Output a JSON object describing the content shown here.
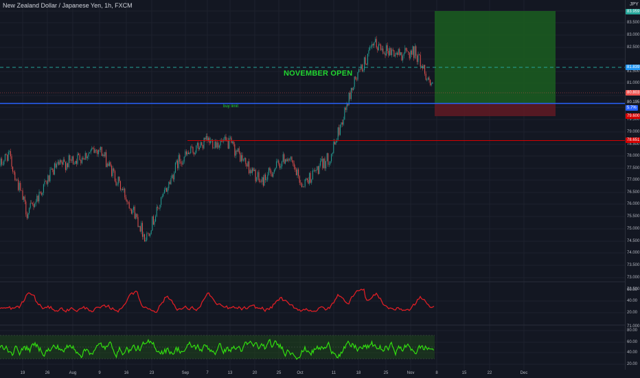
{
  "header": {
    "title": "New Zealand Dollar / Japanese Yen, 1h, FXCM",
    "currency": "JPY"
  },
  "annotations": {
    "november_open": "NOVEMBER OPEN",
    "buy_limit": "buy limit"
  },
  "price_axis": {
    "ticks": [
      "83.500",
      "83.000",
      "82.500",
      "81.500",
      "81.000",
      "79.500",
      "79.000",
      "78.500",
      "78.000",
      "77.500",
      "77.000",
      "76.500",
      "76.000",
      "75.500",
      "75.000",
      "74.500",
      "74.000",
      "73.500",
      "73.000",
      "72.500",
      "71.000"
    ]
  },
  "price_markers": {
    "target": {
      "value": "83.959",
      "color": "#26a69a"
    },
    "dashed_level": {
      "value": "81.839",
      "color": "#2196f3"
    },
    "current": {
      "value": "80.803",
      "color": "#ef5350"
    },
    "entry_plain": {
      "value": "80.195"
    },
    "entry_badge": {
      "value": "5.7%",
      "color": "#2962ff"
    },
    "stop": {
      "value": "79.600",
      "color": "#d50000"
    },
    "red_line": {
      "value": "78.651",
      "color": "#d50000"
    }
  },
  "indicator_axis": {
    "upper": [
      "60.00",
      "40.00",
      "20.00"
    ],
    "lower": [
      "80.00",
      "60.00",
      "40.00",
      "20.00"
    ]
  },
  "time_axis": {
    "labels": [
      "19",
      "26",
      "Aug",
      "9",
      "16",
      "23",
      "Sep",
      "7",
      "13",
      "20",
      "25",
      "Oct",
      "11",
      "18",
      "25",
      "Nov",
      "8",
      "15",
      "22",
      "Dec"
    ]
  },
  "colors": {
    "background": "#131722",
    "up": "#26a69a",
    "down": "#ef5350",
    "profit_zone": "#1b5e20",
    "loss_zone": "#5d1a24",
    "rsi": "#e01e25",
    "oscillator": "#32e00f"
  },
  "chart_data": {
    "type": "candlestick",
    "symbol": "NZDJPY",
    "timeframe": "1h",
    "y_range": [
      73.5,
      83.8
    ],
    "keypoints": [
      {
        "t": "Jul 15",
        "price": 77.6
      },
      {
        "t": "Jul 17",
        "price": 78.1
      },
      {
        "t": "Jul 21",
        "price": 75.6
      },
      {
        "t": "Jul 28",
        "price": 77.5
      },
      {
        "t": "Aug 9",
        "price": 78.3
      },
      {
        "t": "Aug 18",
        "price": 75.7
      },
      {
        "t": "Aug 20",
        "price": 74.6
      },
      {
        "t": "Aug 30",
        "price": 77.8
      },
      {
        "t": "Sep 7",
        "price": 78.6
      },
      {
        "t": "Sep 13",
        "price": 78.5
      },
      {
        "t": "Sep 20",
        "price": 76.9
      },
      {
        "t": "Sep 28",
        "price": 78.0
      },
      {
        "t": "Oct 4",
        "price": 76.8
      },
      {
        "t": "Oct 12",
        "price": 78.0
      },
      {
        "t": "Oct 16",
        "price": 81.0
      },
      {
        "t": "Oct 21",
        "price": 82.6
      },
      {
        "t": "Oct 28",
        "price": 82.2
      },
      {
        "t": "Nov 1",
        "price": 82.3
      },
      {
        "t": "Nov 4",
        "price": 80.8
      }
    ],
    "levels": {
      "dashed": 81.839,
      "buy_limit": 80.195,
      "resistance": 78.651
    },
    "long_position": {
      "entry": 80.195,
      "target": 83.959,
      "stop": 79.6
    },
    "indicators": [
      {
        "name": "upper",
        "color": "red",
        "ylim": [
          10,
          70
        ]
      },
      {
        "name": "lower",
        "color": "green",
        "ylim": [
          10,
          100
        ],
        "band": [
          30,
          70
        ]
      }
    ]
  }
}
